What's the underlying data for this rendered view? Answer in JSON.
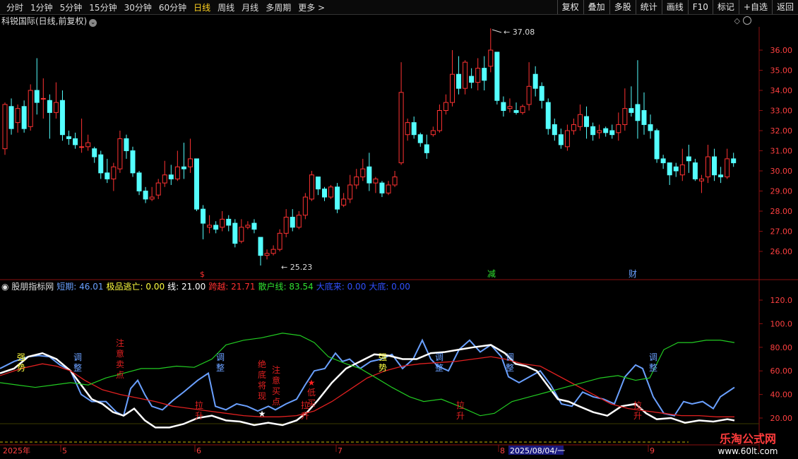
{
  "toolbar": {
    "periods": [
      "分时",
      "1分钟",
      "5分钟",
      "15分钟",
      "30分钟",
      "60分钟",
      "日线",
      "周线",
      "月线",
      "多周期",
      "更多 >"
    ],
    "active_index": 6,
    "right_buttons": [
      "复权",
      "叠加",
      "多股",
      "统计",
      "画线",
      "F10",
      "标记",
      "+自选",
      "返回"
    ]
  },
  "title": "科锐国际(日线,前复权)",
  "price_panel": {
    "y_ticks": [
      "36.00",
      "35.00",
      "34.00",
      "33.00",
      "32.00",
      "31.00",
      "30.00",
      "29.00",
      "28.00",
      "27.00",
      "26.00"
    ],
    "high_label": "37.08",
    "low_label": "25.23",
    "markers": [
      "$",
      "减",
      "财"
    ]
  },
  "indicator": {
    "name": "股朋指标网",
    "items": [
      {
        "label": "短期:",
        "value": "46.01",
        "color": "#6aa0ff"
      },
      {
        "label": "极品逃亡:",
        "value": "0.00",
        "color": "#ffff40"
      },
      {
        "label": "线:",
        "value": "21.00",
        "color": "#ffffff"
      },
      {
        "label": "跨越:",
        "value": "21.71",
        "color": "#ff3030"
      },
      {
        "label": "散户线:",
        "value": "83.54",
        "color": "#30e030"
      },
      {
        "label": "大底来:",
        "value": "0.00",
        "color": "#3050ff"
      },
      {
        "label": "大底:",
        "value": "0.00",
        "color": "#3050ff"
      }
    ],
    "y_ticks": [
      "120.0",
      "100.0",
      "80.00",
      "60.00",
      "40.00",
      "20.00"
    ],
    "annotations": [
      "强势",
      "调整",
      "注意卖点",
      "拉升",
      "调整",
      "绝底将现",
      "注意买点",
      "低买",
      "拉升",
      "强势",
      "调整",
      "拉升",
      "调整",
      "拉升",
      "调整"
    ]
  },
  "date_axis": {
    "year_label": "2025年",
    "months": [
      "5",
      "6",
      "7",
      "8",
      "9"
    ],
    "cursor_date": "2025/08/04/一"
  },
  "logo": {
    "title": "乐淘公式网",
    "url": "www.60lt.com"
  },
  "colors": {
    "up": "#ff3232",
    "down": "#54ffff",
    "short": "#6aa0ff",
    "line": "#ffffff",
    "cross": "#e02020",
    "retail": "#22cc22"
  }
}
